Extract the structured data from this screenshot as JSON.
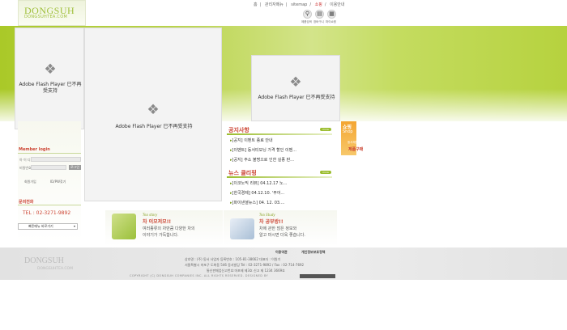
{
  "header": {
    "logo": "DONGSUH",
    "logo_sub": "DONGSUHTEA.COM",
    "top_links": [
      "홈",
      "관리자메뉴",
      "sitemap",
      "쇼핑",
      "이용안내"
    ],
    "tools": [
      {
        "label": "제품검색",
        "icon": "magnifier-icon"
      },
      {
        "label": "장바구니",
        "icon": "cart-icon"
      },
      {
        "label": "마이쇼핑",
        "icon": "bag-icon"
      }
    ]
  },
  "flash": {
    "message1": "Adobe Flash Player 已不再受支持",
    "message2": "Adobe Flash Player 已不再受支持",
    "message3": "Adobe Flash Player 已不再受支持"
  },
  "login": {
    "title": "Member login",
    "id_label": "아 이 디",
    "pw_label": "비밀번호",
    "login_button": "로그인",
    "join_link": "회원가입",
    "find_link": "ID/PW찾기"
  },
  "contact": {
    "title": "문의전화",
    "phone": "TEL : 02-3271-9892"
  },
  "quick_menu": {
    "selected": "빠른메뉴 바로가기"
  },
  "notice": {
    "title": "공지사항",
    "more": "more",
    "items": [
      "[공지] 이벤트 종료 안내",
      "[이벤트] 동서티모닝 가격 할인 이벤...",
      "[공지] 주소 불명으로 인한 실종 판..."
    ]
  },
  "news": {
    "title": "뉴스 클리핑",
    "more": "more",
    "items": [
      "[이코노믹 리뷰] 04.12.17 노...",
      "[한국경제] 04.12.10. '부어...",
      "[파이낸셜뉴스] 04. 12. 03...."
    ]
  },
  "shop_banner": {
    "line1": "쇼핑",
    "line2": "Shop",
    "line3": "동서제품을",
    "line4": "쉽게",
    "line5": "제품구매"
  },
  "story": {
    "tag": "Tea story",
    "title": "차 이모저모!!",
    "text1": "여러종류의 차만큼 다양한 차의",
    "text2": "이야기가 가득합니다."
  },
  "study": {
    "tag": "Tea Study",
    "title": "차 공부방!!",
    "text1": "차에 관한 많은 정보와",
    "text2": "알고 마시면 더욱 좋습니다."
  },
  "footer": {
    "logo": "DONGSUH",
    "logo_sub": "DONGSUHTEA.COM",
    "link1": "이용약관",
    "link2": "개인정보보호정책",
    "line1": "상호명 : (주) 동서      사업자 등록번호 : 105-81-38662       대표자 : 이원기",
    "line2": "서울특별시 마포구 도화동 546 동서빌딩    Tel : 02-3271-9892 / Fax : 02-714-7692",
    "line3": "통신판매업신고번호:마포제 제3호    신고 제 1234 3669호",
    "line4": "COPYRIGHT (C) DONGSUH COMPANIES INC. ALL RIGHTS RESERVED. DESIGNED BY"
  }
}
